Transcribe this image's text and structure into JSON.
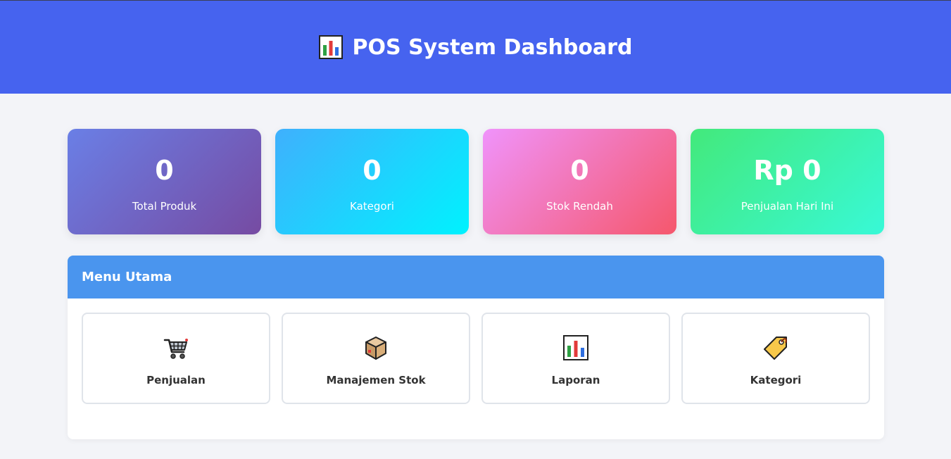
{
  "header": {
    "title": "POS System Dashboard",
    "icon": "bar-chart-icon"
  },
  "stats": [
    {
      "value": "0",
      "label": "Total Produk"
    },
    {
      "value": "0",
      "label": "Kategori"
    },
    {
      "value": "0",
      "label": "Stok Rendah"
    },
    {
      "value": "Rp 0",
      "label": "Penjualan Hari Ini"
    }
  ],
  "menu": {
    "title": "Menu Utama",
    "items": [
      {
        "label": "Penjualan",
        "icon": "shopping-cart-icon"
      },
      {
        "label": "Manajemen Stok",
        "icon": "package-box-icon"
      },
      {
        "label": "Laporan",
        "icon": "bar-chart-icon"
      },
      {
        "label": "Kategori",
        "icon": "price-tag-icon"
      }
    ]
  },
  "colors": {
    "header_bg": "#4663ef",
    "menu_header_bg": "#4a95ee",
    "page_bg": "#f3f4f8"
  }
}
